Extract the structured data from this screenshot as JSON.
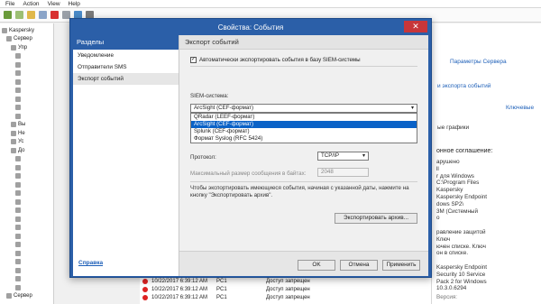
{
  "menubar": [
    "File",
    "Action",
    "View",
    "Help"
  ],
  "tree": {
    "items": [
      {
        "label": "Kaspersky",
        "indent": 0
      },
      {
        "label": "Сервер",
        "indent": 1
      },
      {
        "label": "Упр",
        "indent": 2
      },
      {
        "label": "",
        "indent": 3
      },
      {
        "label": "",
        "indent": 3
      },
      {
        "label": "",
        "indent": 3
      },
      {
        "label": "",
        "indent": 3
      },
      {
        "label": "",
        "indent": 3
      },
      {
        "label": "",
        "indent": 3
      },
      {
        "label": "",
        "indent": 3
      },
      {
        "label": "",
        "indent": 3
      },
      {
        "label": "Вы",
        "indent": 2
      },
      {
        "label": "Не",
        "indent": 2
      },
      {
        "label": "Ус",
        "indent": 2
      },
      {
        "label": "До",
        "indent": 2
      },
      {
        "label": "",
        "indent": 3
      },
      {
        "label": "",
        "indent": 3
      },
      {
        "label": "",
        "indent": 3
      },
      {
        "label": "",
        "indent": 3
      },
      {
        "label": "",
        "indent": 3
      },
      {
        "label": "",
        "indent": 3
      },
      {
        "label": "",
        "indent": 3
      },
      {
        "label": "",
        "indent": 3
      },
      {
        "label": "",
        "indent": 3
      },
      {
        "label": "",
        "indent": 3
      },
      {
        "label": "",
        "indent": 3
      },
      {
        "label": "",
        "indent": 3
      },
      {
        "label": "",
        "indent": 3
      },
      {
        "label": "",
        "indent": 3
      },
      {
        "label": "",
        "indent": 3
      },
      {
        "label": "",
        "indent": 3
      },
      {
        "label": "Сервер",
        "indent": 1
      }
    ]
  },
  "rightpane": {
    "link1": "Параметры Сервера",
    "link2": "и экспорта событий",
    "link3": "Ключевые",
    "link4": "ые графики",
    "heading": "онное соглашение:",
    "lines": [
      "арушено",
      "ll",
      "r для Windows",
      "C:\\Program Files",
      "Kaspersky",
      "Kaspersky Endpoint",
      "dows SP2\\",
      "3M (Системный",
      "о",
      "",
      "равление защитой",
      "Ключ",
      "ючен списке. Ключ",
      "он в списке.",
      "",
      "Kaspersky Endpoint",
      "Security 10 Service",
      "Pack 2 for Windows",
      "10.3.0.6294"
    ],
    "version_label": "Версия:"
  },
  "bottom_rows": [
    {
      "date": "10/22/2017 6:39:12 AM",
      "pc": "PC1",
      "event": "Доступ запрещен"
    },
    {
      "date": "10/22/2017 6:39:12 AM",
      "pc": "PC1",
      "event": "Доступ запрещен"
    },
    {
      "date": "10/22/2017 6:39:12 AM",
      "pc": "PC1",
      "event": "Доступ запрещен"
    }
  ],
  "dialog": {
    "title": "Свойства: События",
    "close": "✕",
    "sidebar_title": "Разделы",
    "sidebar_items": [
      "Уведомление",
      "Отправители SMS",
      "Экспорт событий"
    ],
    "active_index": 2,
    "help_link": "Справка",
    "section_title": "Экспорт событий",
    "auto_export_label": "Автоматически экспортировать события в базу SIEM-системы",
    "auto_export_checked": true,
    "siem_label": "SIEM-система:",
    "siem_selected": "ArcSight (CEF-формат)",
    "siem_options": [
      "QRadar (LEEF-формат)",
      "ArcSight (CEF-формат)",
      "Splunk (CEF-формат)",
      "Формат Syslog (RFC 5424)"
    ],
    "siem_highlight_index": 1,
    "protocol_label": "Протокол:",
    "protocol_value": "TCP/IP",
    "maxsize_label": "Максимальный размер сообщения в байтах:",
    "maxsize_value": "2048",
    "archive_hint": "Чтобы экспортировать имеющиеся события, начиная с указанной даты, нажмите на кнопку \"Экспортировать архив\".",
    "archive_button": "Экспортировать архив...",
    "ok": "OK",
    "cancel": "Отмена",
    "apply": "Применить"
  }
}
